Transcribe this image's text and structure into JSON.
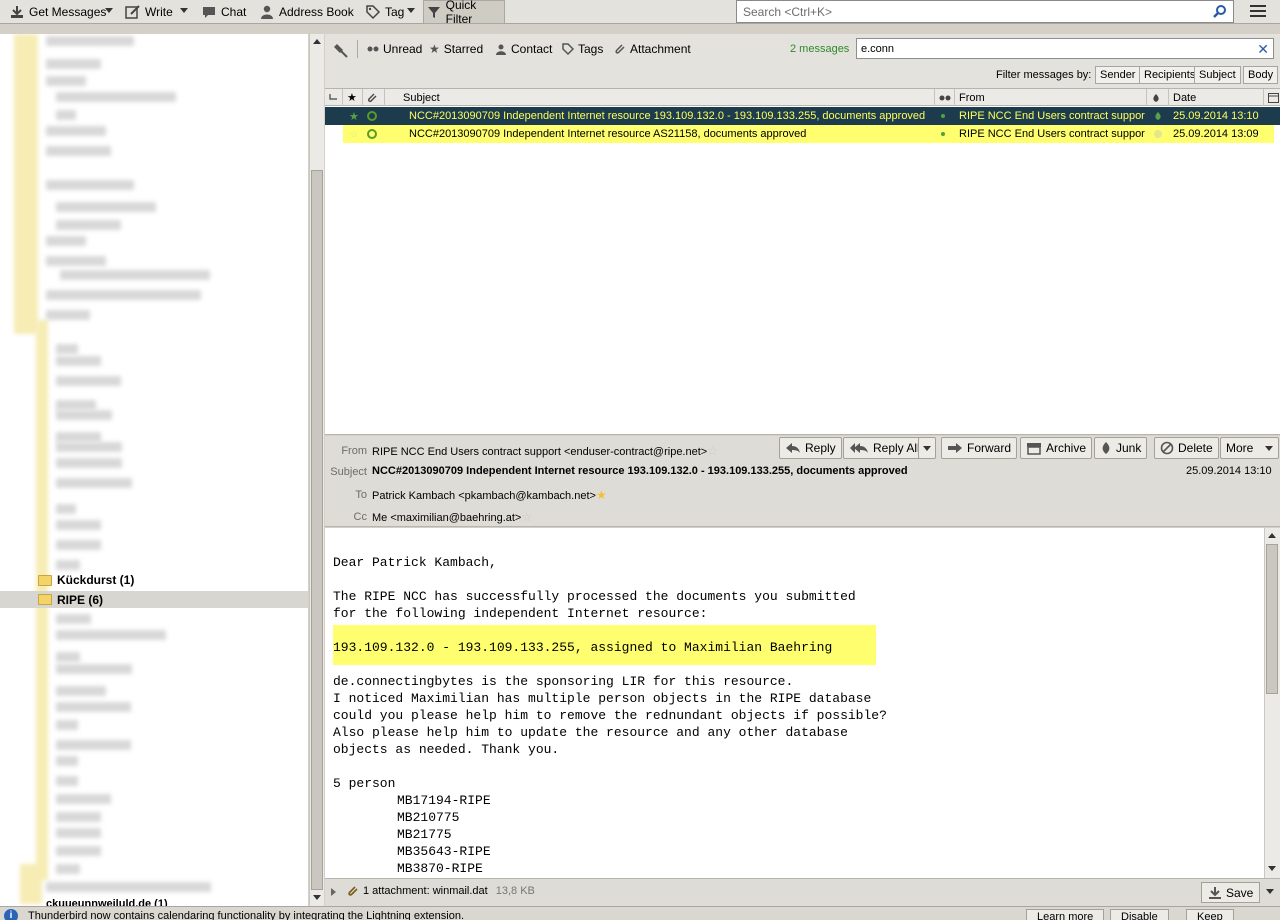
{
  "toolbar": {
    "get_messages": "Get Messages",
    "write": "Write",
    "chat": "Chat",
    "address_book": "Address Book",
    "tag": "Tag",
    "quick_filter": "Quick Filter",
    "search_placeholder": "Search <Ctrl+K>"
  },
  "folders": {
    "partial_label": "Kückdurst (1)",
    "selected_label": "RIPE (6)",
    "bottom_partial": "ckuueunnweiluld.de (1)"
  },
  "quick_filter": {
    "unread": "Unread",
    "starred": "Starred",
    "contact": "Contact",
    "tags": "Tags",
    "attachment": "Attachment",
    "count": "2 messages",
    "query": "e.conn",
    "filter_by": "Filter messages by:",
    "sender": "Sender",
    "recipients": "Recipients",
    "subject": "Subject",
    "body": "Body"
  },
  "thread": {
    "col_subject": "Subject",
    "col_from": "From",
    "col_date": "Date",
    "rows": [
      {
        "subject": "NCC#2013090709 Independent Internet resource 193.109.132.0 - 193.109.133.255, documents approved",
        "from": "RIPE NCC End Users contract support",
        "date": "25.09.2014 13:10"
      },
      {
        "subject": "NCC#2013090709 Independent Internet resource AS21158, documents approved",
        "from": "RIPE NCC End Users contract support",
        "date": "25.09.2014 13:09"
      }
    ]
  },
  "header": {
    "from_label": "From",
    "from": "RIPE NCC End Users contract support <enduser-contract@ripe.net>",
    "subject_label": "Subject",
    "subject": "NCC#2013090709 Independent Internet resource 193.109.132.0 - 193.109.133.255, documents approved",
    "date": "25.09.2014 13:10",
    "to_label": "To",
    "to": "Patrick Kambach <pkambach@kambach.net>",
    "cc_label": "Cc",
    "cc": "Me <maximilian@baehring.at>",
    "reply": "Reply",
    "reply_all": "Reply All",
    "forward": "Forward",
    "archive": "Archive",
    "junk": "Junk",
    "delete": "Delete",
    "more": "More"
  },
  "body": {
    "greeting": "Dear Patrick Kambach,",
    "p1_l1": "The RIPE NCC has successfully processed the documents you submitted",
    "p1_l2": "for the following independent Internet resource:",
    "highlight": "193.109.132.0 - 193.109.133.255, assigned to Maximilian Baehring",
    "p2_l1": "de.connectingbytes is the sponsoring LIR for this resource.",
    "p2_l2": "I noticed Maximilian has multiple person objects in the RIPE database",
    "p2_l3": "could you please help him to remove the rednundant objects if possible?",
    "p2_l4": "Also please help him to update the resource and any other database",
    "p2_l5": "objects as needed. Thank you.",
    "person_head": "5 person",
    "persons": [
      "MB17194-RIPE",
      "MB210775",
      "MB21775",
      "MB35643-RIPE",
      "MB3870-RIPE"
    ]
  },
  "attachment": {
    "label": "1 attachment: winmail.dat",
    "size": "13,8 KB",
    "save": "Save"
  },
  "notification": {
    "text": "Thunderbird now contains calendaring functionality by integrating the Lightning extension.",
    "learn_more": "Learn more",
    "disable": "Disable",
    "keep": "Keep"
  }
}
